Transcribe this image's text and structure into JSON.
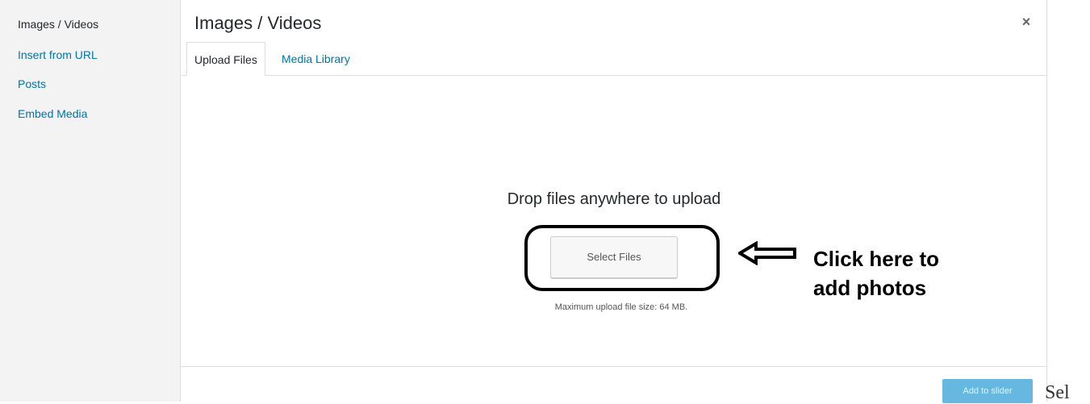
{
  "sidebar": {
    "items": [
      {
        "label": "Images / Videos",
        "active": true
      },
      {
        "label": "Insert from URL",
        "active": false
      },
      {
        "label": "Posts",
        "active": false
      },
      {
        "label": "Embed Media",
        "active": false
      }
    ]
  },
  "modal": {
    "title": "Images / Videos",
    "close_icon": "×",
    "tabs": [
      {
        "label": "Upload Files",
        "active": true
      },
      {
        "label": "Media Library",
        "active": false
      }
    ]
  },
  "uploader": {
    "drop_text": "Drop files anywhere to upload",
    "select_button": "Select Files",
    "max_size": "Maximum upload file size: 64 MB."
  },
  "annotation": {
    "line1": "Click here to",
    "line2": "add photos",
    "arrow_icon": "left-arrow-icon"
  },
  "footer": {
    "add_button": "Add to slider"
  },
  "page_fragment": "Sel"
}
